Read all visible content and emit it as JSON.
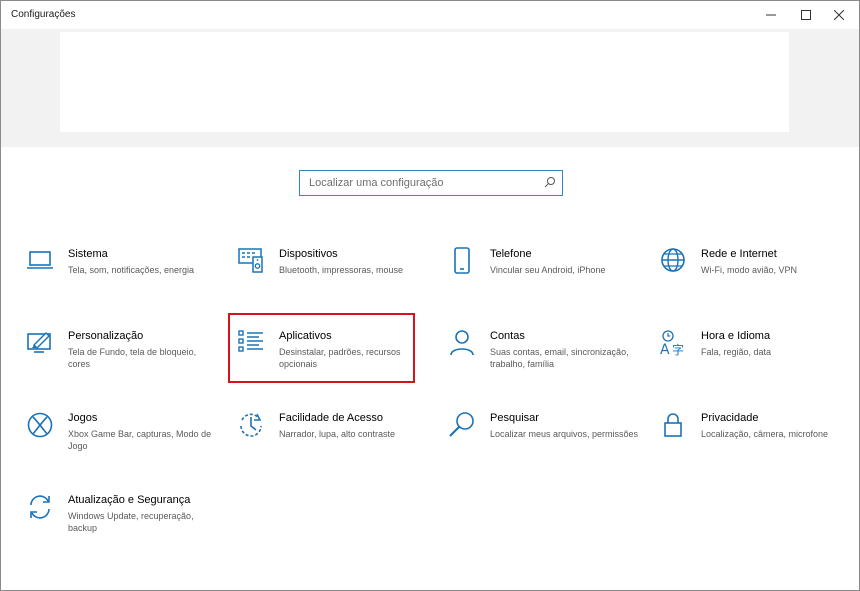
{
  "window": {
    "title": "Configurações"
  },
  "search": {
    "placeholder": "Localizar uma configuração"
  },
  "colors": {
    "accent": "#1a73b8",
    "highlight": "#d6121a"
  },
  "tiles": [
    {
      "title": "Sistema",
      "desc": "Tela, som, notificações, energia",
      "icon": "laptop-icon"
    },
    {
      "title": "Dispositivos",
      "desc": "Bluetooth, impressoras, mouse",
      "icon": "devices-icon"
    },
    {
      "title": "Telefone",
      "desc": "Vincular seu Android, iPhone",
      "icon": "phone-icon"
    },
    {
      "title": "Rede e Internet",
      "desc": "Wi-Fi, modo avião, VPN",
      "icon": "globe-icon"
    },
    {
      "title": "Personalização",
      "desc": "Tela de Fundo, tela de bloqueio, cores",
      "icon": "paint-icon"
    },
    {
      "title": "Aplicativos",
      "desc": "Desinstalar, padrões, recursos opcionais",
      "icon": "apps-list-icon"
    },
    {
      "title": "Contas",
      "desc": "Suas contas, email, sincronização, trabalho, família",
      "icon": "person-icon"
    },
    {
      "title": "Hora e Idioma",
      "desc": "Fala, região, data",
      "icon": "language-icon"
    },
    {
      "title": "Jogos",
      "desc": "Xbox Game Bar, capturas, Modo de Jogo",
      "icon": "xbox-icon"
    },
    {
      "title": "Facilidade de Acesso",
      "desc": "Narrador, lupa, alto contraste",
      "icon": "ease-of-access-icon"
    },
    {
      "title": "Pesquisar",
      "desc": "Localizar meus arquivos, permissões",
      "icon": "magnifier-icon"
    },
    {
      "title": "Privacidade",
      "desc": "Localização, câmera, microfone",
      "icon": "lock-icon"
    },
    {
      "title": "Atualização e Segurança",
      "desc": "Windows Update, recuperação, backup",
      "icon": "sync-icon"
    }
  ]
}
